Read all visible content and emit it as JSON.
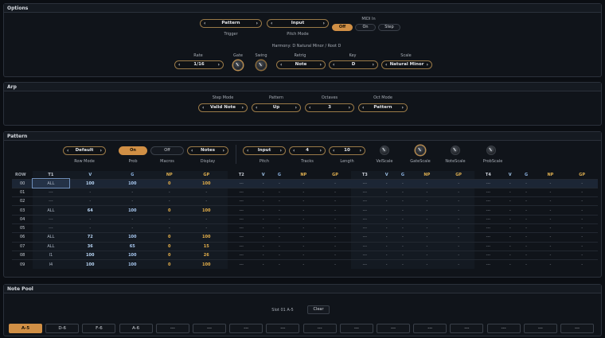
{
  "options": {
    "title": "Options",
    "trigger": {
      "value": "Pattern",
      "label": "Trigger"
    },
    "pitch_mode": {
      "value": "Input",
      "label": "Pitch Mode"
    },
    "midi_in": {
      "label": "MIDI In",
      "buttons": [
        "Off",
        "On",
        "Step"
      ]
    },
    "harmony": "Harmony: D Natural Minor / Root D",
    "rate": {
      "label": "Rate",
      "value": "1/16"
    },
    "gate": {
      "label": "Gate"
    },
    "swing": {
      "label": "Swing"
    },
    "retrig": {
      "label": "Retrig",
      "value": "Note"
    },
    "key": {
      "label": "Key",
      "value": "D"
    },
    "scale": {
      "label": "Scale",
      "value": "Natural Minor"
    }
  },
  "arp": {
    "title": "Arp",
    "step_mode": {
      "label": "Step Mode",
      "value": "Valid Note"
    },
    "pattern": {
      "label": "Pattern",
      "value": "Up"
    },
    "octaves": {
      "label": "Octaves",
      "value": "3"
    },
    "oct_mode": {
      "label": "Oct Mode",
      "value": "Pattern"
    }
  },
  "pattern": {
    "title": "Pattern",
    "row_mode": {
      "label": "Row Mode",
      "value": "Default"
    },
    "prob": {
      "label": "Prob",
      "value": "On"
    },
    "macros": {
      "label": "Macros",
      "value": "Off"
    },
    "display": {
      "label": "Display",
      "value": "Notes"
    },
    "pitch": {
      "label": "Pitch",
      "value": "Input"
    },
    "tracks": {
      "label": "Tracks",
      "value": "4"
    },
    "length": {
      "label": "Length",
      "value": "10"
    },
    "knobs": [
      "VelScale",
      "GateScale",
      "NoteScale",
      "ProbScale"
    ],
    "headers": [
      "ROW",
      "T1",
      "V",
      "G",
      "NP",
      "GP",
      "T2",
      "V",
      "G",
      "NP",
      "GP",
      "T3",
      "V",
      "G",
      "NP",
      "GP",
      "T4",
      "V",
      "G",
      "NP",
      "GP"
    ],
    "rows": [
      [
        "00",
        "ALL",
        "100",
        "100",
        "0",
        "100"
      ],
      [
        "01",
        "---",
        "-",
        "-",
        "-",
        "-"
      ],
      [
        "02",
        "---",
        "-",
        "-",
        "-",
        "-"
      ],
      [
        "03",
        "ALL",
        "64",
        "100",
        "0",
        "100"
      ],
      [
        "04",
        "---",
        "-",
        "-",
        "-",
        "-"
      ],
      [
        "05",
        "---",
        "-",
        "-",
        "-",
        "-"
      ],
      [
        "06",
        "ALL",
        "72",
        "100",
        "0",
        "100"
      ],
      [
        "07",
        "ALL",
        "36",
        "65",
        "0",
        "15"
      ],
      [
        "08",
        "I1",
        "100",
        "100",
        "0",
        "26"
      ],
      [
        "09",
        "I4",
        "100",
        "100",
        "0",
        "100"
      ]
    ],
    "empty_track": [
      "---",
      "-",
      "-",
      "-",
      "-"
    ]
  },
  "note_pool": {
    "title": "Note Pool",
    "slot": "Slot 01 A-5",
    "clear": "Clear",
    "slots": [
      "A-5",
      "D-6",
      "F-6",
      "A-6",
      "---",
      "---",
      "---",
      "---",
      "---",
      "---",
      "---",
      "---",
      "---",
      "---",
      "---",
      "---"
    ]
  }
}
